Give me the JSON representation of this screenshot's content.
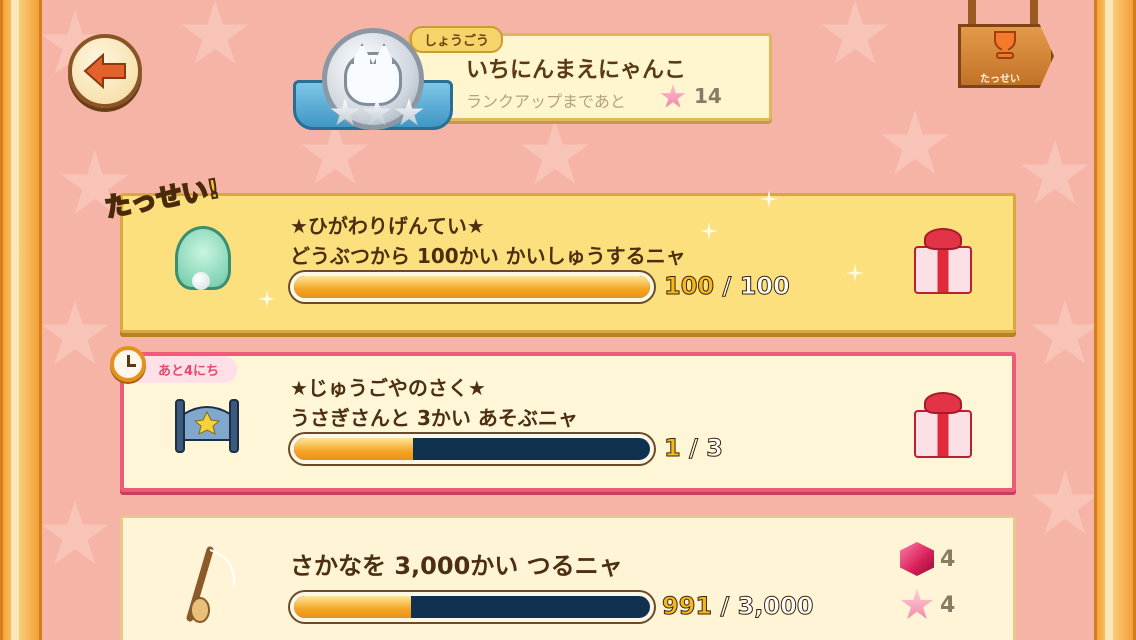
{
  "header": {
    "title_tag": "しょうごう",
    "title": "いちにんまえにゃんこ",
    "rank_up_text": "ランクアップまであと",
    "rank_up_count": "14",
    "achievements_label": "たっせい"
  },
  "missions": [
    {
      "status_badge": "たっせい!",
      "title_line1": "★ひがわりげんてい★",
      "title_line2": "どうぶつから 100かい かいしゅうするニャ",
      "progress_current": "100",
      "progress_separator": "/",
      "progress_max": "100",
      "progress_fraction": 1.0,
      "icon": "shell-icon",
      "reward_icon": "gift-icon"
    },
    {
      "timer_text": "あと4にち",
      "title_line1": "★じゅうごやのさく★",
      "title_line2": "うさぎさんと 3かい あそぶニャ",
      "progress_current": "1",
      "progress_separator": "/",
      "progress_max": "3",
      "progress_fraction": 0.333,
      "icon": "fence-icon",
      "reward_icon": "gift-icon"
    },
    {
      "title_line1": "さかなを 3,000かい つるニャ",
      "progress_current": "991",
      "progress_separator": "/",
      "progress_max": "3,000",
      "progress_fraction": 0.33,
      "icon": "fishing-rod-icon",
      "rewards": [
        {
          "icon": "gem-icon",
          "count": "4"
        },
        {
          "icon": "pink-star-icon",
          "count": "4"
        }
      ]
    }
  ]
}
